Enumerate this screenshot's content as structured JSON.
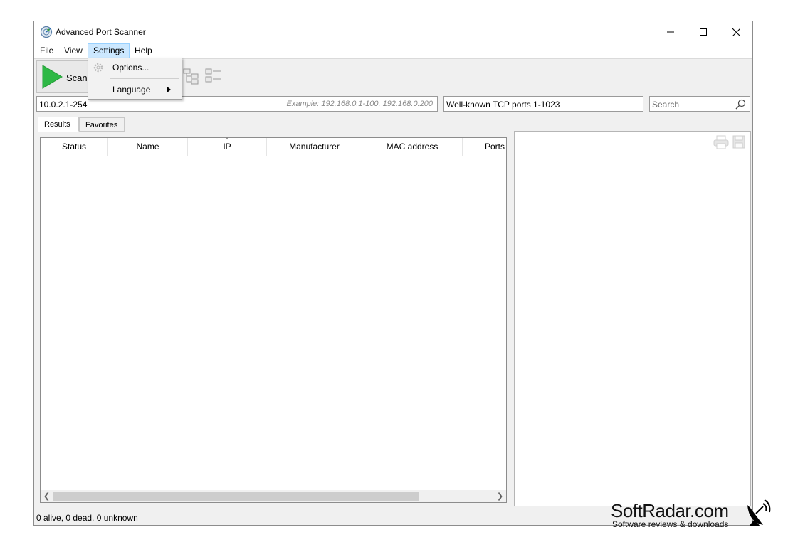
{
  "window": {
    "title": "Advanced Port Scanner",
    "app_icon": "radar-icon",
    "minimize_icon": "minimize-icon",
    "maximize_icon": "maximize-icon",
    "close_icon": "close-icon"
  },
  "menubar": {
    "items": [
      {
        "label": "File"
      },
      {
        "label": "View"
      },
      {
        "label": "Settings"
      },
      {
        "label": "Help"
      }
    ]
  },
  "settings_menu": {
    "options_label": "Options...",
    "language_label": "Language",
    "options_icon": "gear-icon",
    "submenu_icon": "chevron-right-icon"
  },
  "toolbar": {
    "scan_label": "Scan",
    "scan_icon": "play-icon",
    "expand_icon": "expand-tree-icon",
    "collapse_icon": "collapse-tree-icon"
  },
  "inputs": {
    "ip_range_value": "10.0.2.1-254",
    "ip_range_hint": "Example: 192.168.0.1-100, 192.168.0.200",
    "ports_value": "Well-known TCP ports 1-1023",
    "search_placeholder": "Search",
    "search_icon": "search-icon"
  },
  "tabs": [
    {
      "label": "Results"
    },
    {
      "label": "Favorites"
    }
  ],
  "results_table": {
    "columns": [
      "Status",
      "Name",
      "IP",
      "Manufacturer",
      "MAC address",
      "Ports"
    ],
    "sorted_column": "IP",
    "rows": []
  },
  "details_panel": {
    "print_icon": "print-icon",
    "save_icon": "save-icon"
  },
  "statusbar": {
    "text": "0 alive, 0 dead, 0 unknown"
  },
  "watermark": {
    "title": "SoftRadar.com",
    "subtitle": "Software reviews & downloads",
    "logo_icon": "satellite-dish-icon"
  },
  "colors": {
    "play_green": "#2eb845",
    "menu_highlight": "#cce8ff",
    "window_bg": "#f0f0f0"
  }
}
